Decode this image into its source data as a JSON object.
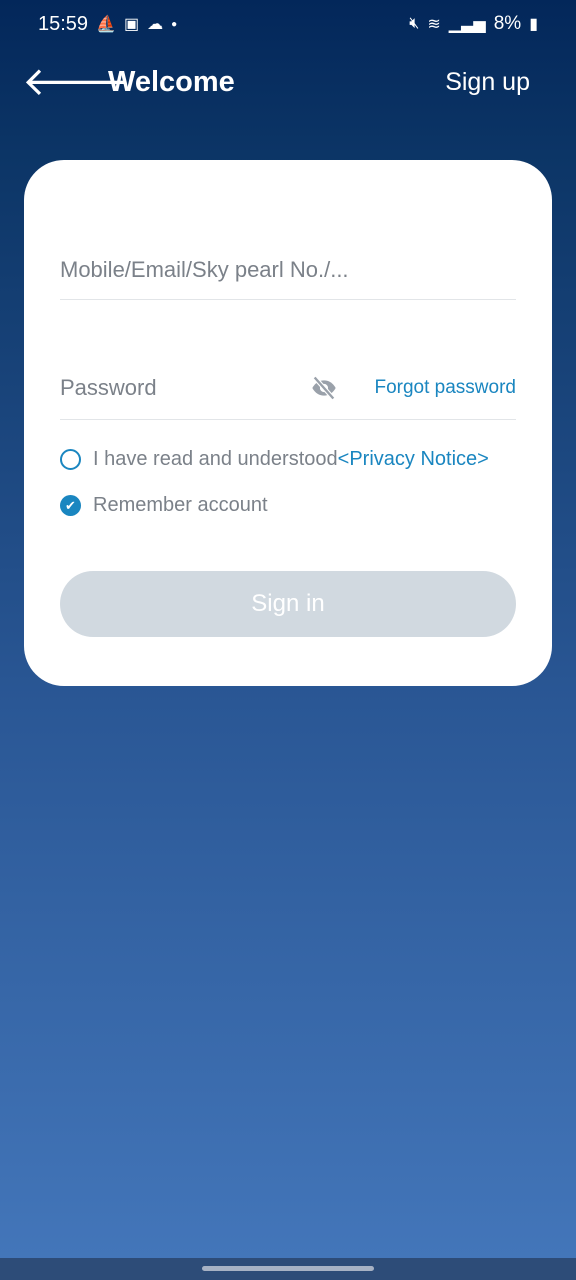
{
  "status": {
    "time": "15:59",
    "battery": "8%",
    "icons": [
      "sailboat-icon",
      "image-icon",
      "cloud-icon",
      "dot-icon",
      "mute-icon",
      "wifi-icon",
      "signal-icon",
      "battery-charging-icon"
    ]
  },
  "header": {
    "title": "Welcome",
    "sign_up": "Sign up",
    "back_icon": "arrow-left-icon"
  },
  "form": {
    "account_placeholder": "Mobile/Email/Sky pearl No./...",
    "password_placeholder": "Password",
    "forgot": "Forgot password",
    "privacy_text": "I have read and understood",
    "privacy_link": "<Privacy Notice>",
    "privacy_checked": false,
    "remember": "Remember account",
    "remember_checked": true,
    "sign_in": "Sign in"
  },
  "colors": {
    "accent": "#1a86c0",
    "button_disabled": "#d1d9e0"
  }
}
